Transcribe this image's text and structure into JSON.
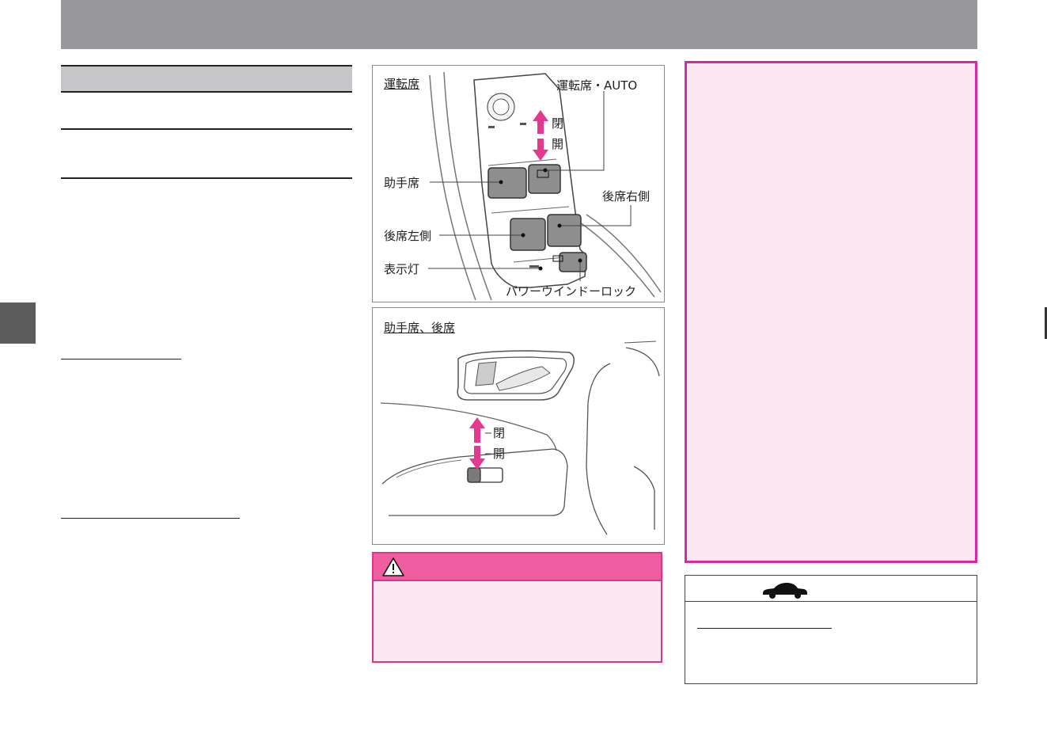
{
  "figures": {
    "driver": {
      "title": "運転席",
      "labels": {
        "auto": "運転席・AUTO",
        "close": "閉",
        "open": "開",
        "passenger": "助手席",
        "rear_right": "後席右側",
        "rear_left": "後席左側",
        "indicator": "表示灯",
        "lock": "パワーウインドーロック"
      }
    },
    "passenger_rear": {
      "title": "助手席、後席",
      "labels": {
        "close": "閉",
        "open": "開"
      }
    }
  },
  "colors": {
    "header": "#98989c",
    "accent_magenta": "#e0348c",
    "pink_panel_bg": "#fbe7f0",
    "arrow": "#e33a8f"
  },
  "icons": {
    "warning": "warning-triangle-icon",
    "car": "car-icon"
  }
}
